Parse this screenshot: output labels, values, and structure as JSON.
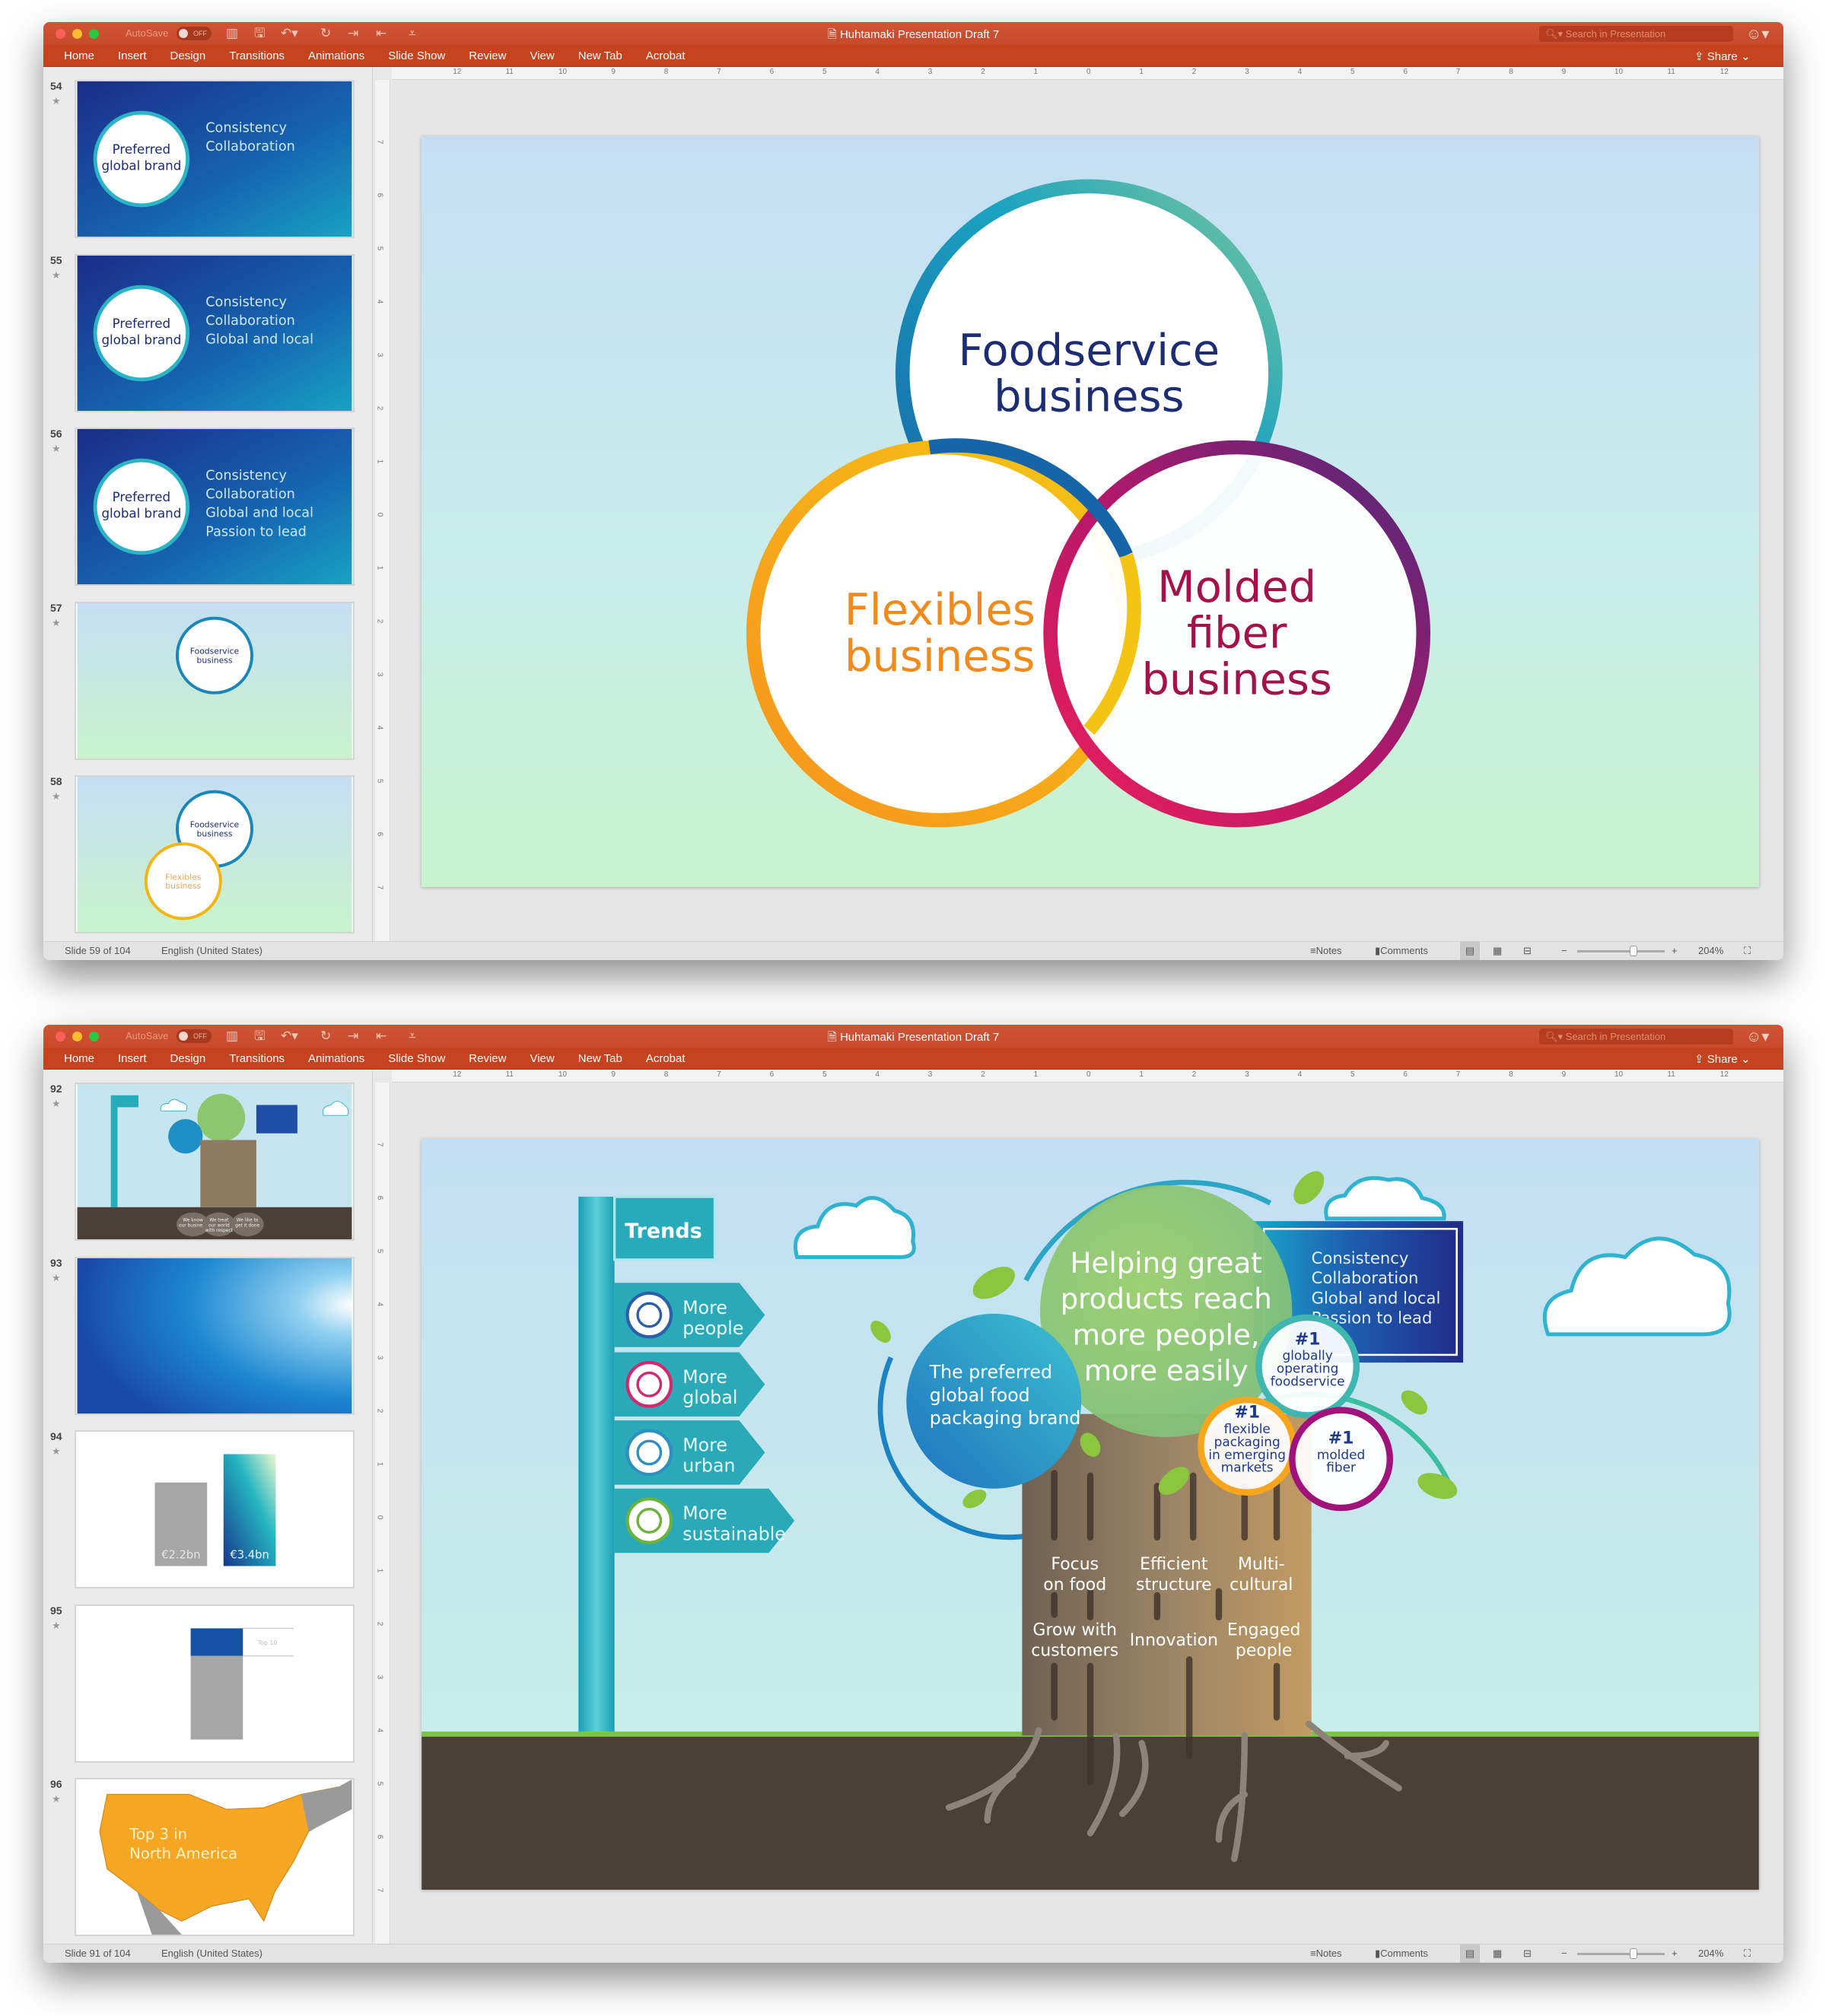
{
  "app": {
    "autosave_label": "AutoSave",
    "autosave_state": "OFF",
    "search_placeholder": "Search in Presentation",
    "share_label": "Share",
    "ribbon_tabs": [
      "Home",
      "Insert",
      "Design",
      "Transitions",
      "Animations",
      "Slide Show",
      "Review",
      "View",
      "New Tab",
      "Acrobat"
    ],
    "hruler_labels": [
      "12",
      "11",
      "10",
      "9",
      "8",
      "7",
      "6",
      "5",
      "4",
      "3",
      "2",
      "1",
      "0",
      "1",
      "2",
      "3",
      "4",
      "5",
      "6",
      "7",
      "8",
      "9",
      "10",
      "11",
      "12"
    ],
    "vruler_labels": [
      "7",
      "6",
      "5",
      "4",
      "3",
      "2",
      "1",
      "0",
      "1",
      "2",
      "3",
      "4",
      "5",
      "6",
      "7"
    ],
    "language": "English (United States)",
    "notes_label": "Notes",
    "comments_label": "Comments",
    "zoom_level": "204%",
    "accent_color": "#c6431f"
  },
  "windows": [
    {
      "title": "Huhtamaki Presentation Draft 7",
      "slide_status": "Slide 59 of 104",
      "thumbnails": [
        {
          "number": "54",
          "circle_text": [
            "Preferred",
            "global brand"
          ],
          "lines": [
            "Consistency",
            "Collaboration"
          ]
        },
        {
          "number": "55",
          "circle_text": [
            "Preferred",
            "global brand"
          ],
          "lines": [
            "Consistency",
            "Collaboration",
            "Global and local"
          ]
        },
        {
          "number": "56",
          "circle_text": [
            "Preferred",
            "global brand"
          ],
          "lines": [
            "Consistency",
            "Collaboration",
            "Global and local",
            "Passion to lead"
          ]
        },
        {
          "number": "57",
          "circle_text": [
            "Foodservice",
            "business"
          ]
        },
        {
          "number": "58",
          "circle_text": [
            "Foodservice",
            "business"
          ],
          "circle2_text": [
            "Flexibles",
            "business"
          ]
        }
      ],
      "slide": {
        "foodservice": [
          "Foodservice",
          "business"
        ],
        "flexibles": [
          "Flexibles",
          "business"
        ],
        "molded": [
          "Molded",
          "fiber",
          "business"
        ],
        "colors": {
          "foodservice": "#1d2d73",
          "flexibles": "#f08a1d",
          "molded": "#a3124a"
        }
      }
    },
    {
      "title": "Huhtamaki Presentation Draft 7",
      "slide_status": "Slide 91 of 104",
      "thumbnails": [
        {
          "number": "92",
          "labels": [
            [
              "We know",
              "our business"
            ],
            [
              "We treat",
              "our world",
              "with respect"
            ],
            [
              "We like to",
              "get it done"
            ]
          ]
        },
        {
          "number": "93"
        },
        {
          "number": "94",
          "bars": [
            "€2.2bn",
            "€3.4bn"
          ]
        },
        {
          "number": "95",
          "label": "Top 10"
        },
        {
          "number": "96",
          "lines": [
            "Top 3 in",
            "North America"
          ]
        }
      ],
      "slide": {
        "trends_title": "Trends",
        "trends": [
          {
            "lines": [
              "More",
              "people"
            ],
            "icon": "people-icon",
            "color": "#2b5fa8"
          },
          {
            "lines": [
              "More",
              "global"
            ],
            "icon": "globe-icon",
            "color": "#d3286e"
          },
          {
            "lines": [
              "More",
              "urban"
            ],
            "icon": "building-icon",
            "color": "#2f8fc0"
          },
          {
            "lines": [
              "More",
              "sustainable"
            ],
            "icon": "sprout-icon",
            "color": "#6bb23a"
          }
        ],
        "mission": [
          "Helping great",
          "products reach",
          "more people,",
          "more easily"
        ],
        "brand": [
          "The preferred",
          "global food",
          "packaging brand"
        ],
        "values": [
          "Consistency",
          "Collaboration",
          "Global and local",
          "Passion to lead"
        ],
        "number_one": [
          {
            "rank": "#1",
            "lines": [
              "globally",
              "operating",
              "foodservice"
            ]
          },
          {
            "rank": "#1",
            "lines": [
              "flexible",
              "packaging",
              "in emerging",
              "markets"
            ]
          },
          {
            "rank": "#1",
            "lines": [
              "molded",
              "fiber"
            ]
          }
        ],
        "trunk": [
          [
            "Focus",
            "on food"
          ],
          [
            "Efficient",
            "structure"
          ],
          [
            "Multi-",
            "cultural"
          ],
          [
            "Grow with",
            "customers"
          ],
          [
            "Innovation"
          ],
          [
            "Engaged",
            "people"
          ]
        ]
      }
    }
  ]
}
